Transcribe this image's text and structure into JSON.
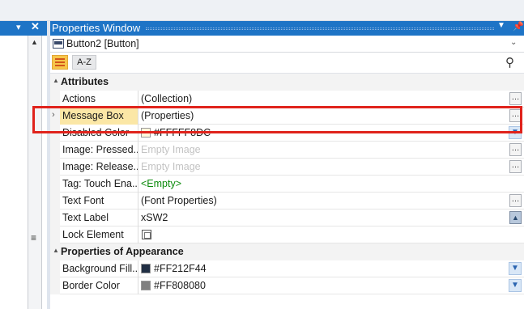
{
  "properties_window": {
    "title": "Properties Window",
    "object_selector": "Button2 [Button]",
    "toolbar": {
      "sort_az_label": "A-Z"
    },
    "categories": [
      {
        "label": "Attributes",
        "rows": [
          {
            "name": "Actions",
            "value": "(Collection)",
            "editor": "dots"
          },
          {
            "name": "Message Box",
            "value": "(Properties)",
            "editor": "dots",
            "expandable": true,
            "selected": true
          },
          {
            "name": "Disabled Color",
            "value": "#FFFFF8DC",
            "editor": "dropdown",
            "swatch": "#FFF8DC"
          },
          {
            "name": "Image: Pressed...",
            "value": "Empty Image",
            "editor": "dots",
            "placeholder": true
          },
          {
            "name": "Image: Release...",
            "value": "Empty Image",
            "editor": "dots",
            "placeholder": true
          },
          {
            "name": "Tag: Touch Ena...",
            "value": "<Empty>",
            "editor": "none",
            "green": true
          },
          {
            "name": "Text Font",
            "value": "(Font Properties)",
            "editor": "dots"
          },
          {
            "name": "Text Label",
            "value": "xSW2",
            "editor": "image"
          },
          {
            "name": "Lock Element",
            "value": "",
            "editor": "checkbox"
          }
        ]
      },
      {
        "label": "Properties of Appearance",
        "rows": [
          {
            "name": "Background Fill...",
            "value": "#FF212F44",
            "editor": "dropdown",
            "swatch": "#212F44"
          },
          {
            "name": "Border Color",
            "value": "#FF808080",
            "editor": "dropdown",
            "swatch": "#808080"
          }
        ]
      }
    ]
  },
  "colors": {
    "accent": "#1E74C6",
    "highlight": "#FBE7A6",
    "annotation": "#E0231C"
  }
}
